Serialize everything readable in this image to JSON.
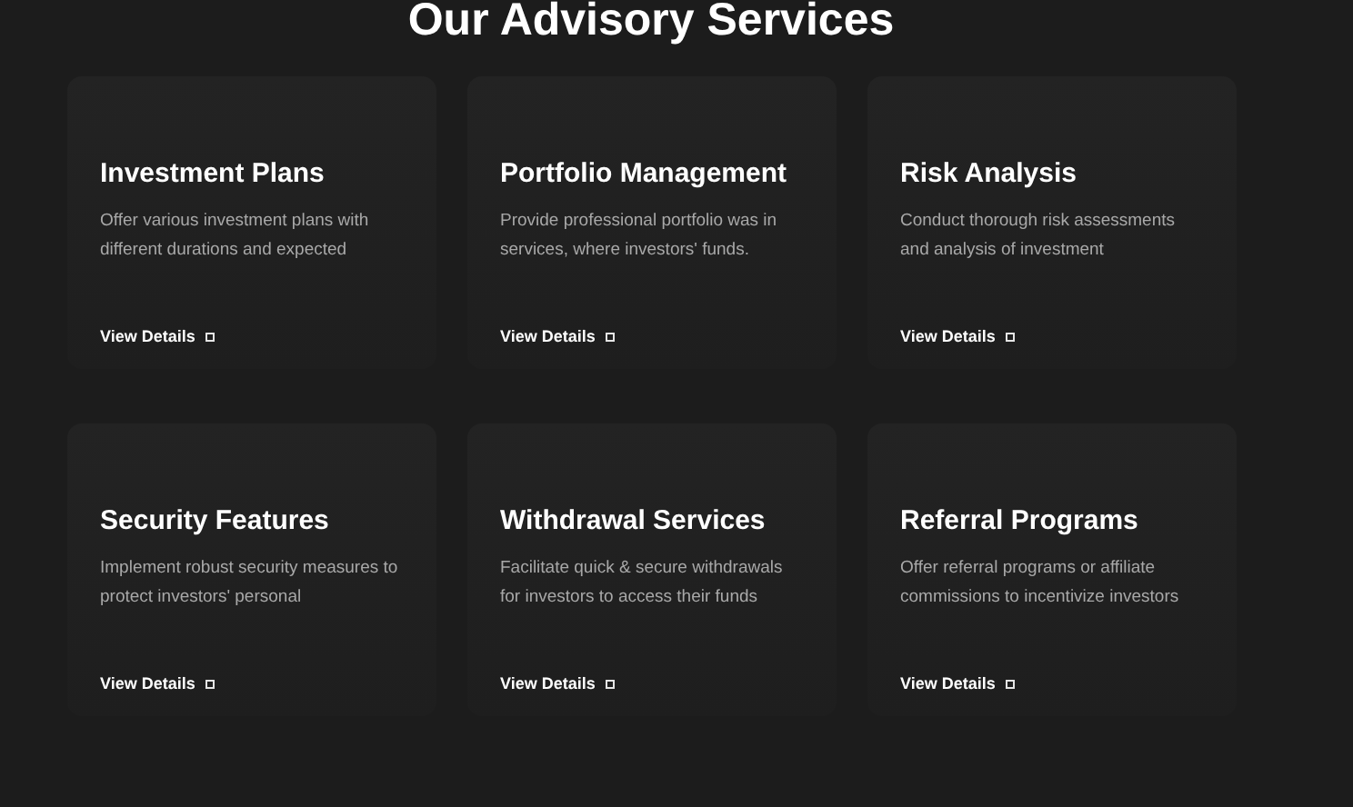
{
  "heading": "Our Advisory Services",
  "services": [
    {
      "title": "Investment Plans",
      "description": "Offer various investment plans with different durations and expected",
      "link": "View Details"
    },
    {
      "title": "Portfolio Management",
      "description": "Provide professional portfolio was in services, where investors' funds.",
      "link": "View Details"
    },
    {
      "title": "Risk Analysis",
      "description": "Conduct thorough risk assessments and analysis of investment",
      "link": "View Details"
    },
    {
      "title": "Security Features",
      "description": "Implement robust security measures to protect investors' personal",
      "link": "View Details"
    },
    {
      "title": "Withdrawal Services",
      "description": "Facilitate quick & secure withdrawals for investors to access their funds",
      "link": "View Details"
    },
    {
      "title": "Referral Programs",
      "description": "Offer referral programs or affiliate commissions to incentivize investors",
      "link": "View Details"
    }
  ]
}
